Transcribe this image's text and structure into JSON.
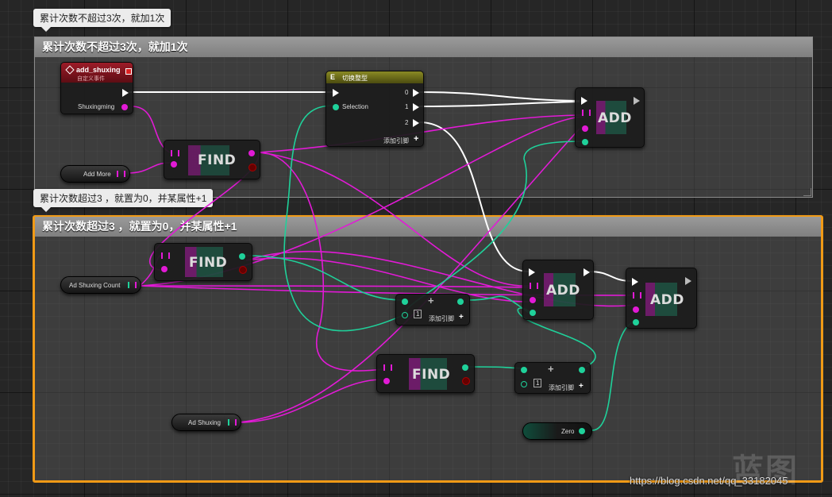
{
  "comments": {
    "top": {
      "bubble": "累计次数不超过3次，就加1次",
      "title": "累计次数不超过3次，就加1次"
    },
    "bottom": {
      "bubble": "累计次数超过3 ，就置为0，并某属性+1",
      "title": "累计次数超过3 ，就置为0，并某属性+1"
    }
  },
  "nodes": {
    "event": {
      "title": "add_shuxing",
      "subtitle": "自定义事件",
      "pin": "Shuxingming"
    },
    "switch": {
      "title": "切换整型",
      "selection": "Selection",
      "out0": "0",
      "out1": "1",
      "out2": "2",
      "add_pin": "添加引脚"
    },
    "find1": {
      "label": "FIND"
    },
    "find2": {
      "label": "FIND"
    },
    "find3": {
      "label": "FIND"
    },
    "add1": {
      "label": "ADD"
    },
    "add2": {
      "label": "ADD"
    },
    "add3": {
      "label": "ADD"
    },
    "make1": {
      "index": "1",
      "add_pin": "添加引脚"
    },
    "make2": {
      "index": "1",
      "add_pin": "添加引脚"
    }
  },
  "variables": {
    "add_more": "Add More",
    "ad_shuxing_count": "Ad Shuxing Count",
    "ad_shuxing": "Ad Shuxing",
    "zero": "Zero"
  },
  "watermark": {
    "url": "https://blog.csdn.net/qq_33182045",
    "logo": "蓝图"
  },
  "colors": {
    "exec": "#ffffff",
    "map": "#e21ad6",
    "int": "#1fd19a",
    "comment_selected": "#f09a16"
  }
}
